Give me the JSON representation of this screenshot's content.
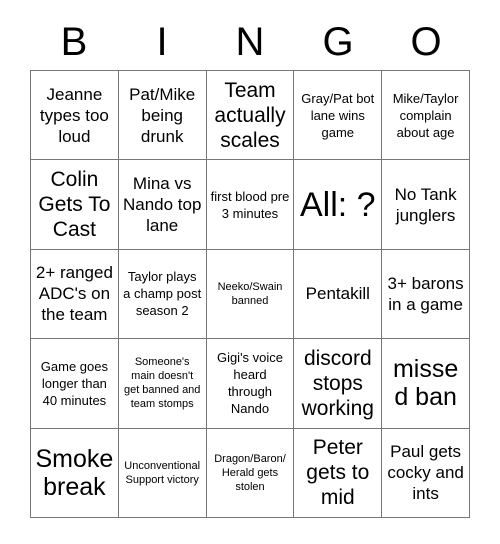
{
  "card": {
    "header_letters": [
      "B",
      "I",
      "N",
      "G",
      "O"
    ],
    "rows": [
      [
        {
          "text": "Jeanne types too loud",
          "size": "sz-md"
        },
        {
          "text": "Pat/Mike being drunk",
          "size": "sz-md"
        },
        {
          "text": "Team actually scales",
          "size": "sz-lg"
        },
        {
          "text": "Gray/Pat bot lane wins game",
          "size": "sz-sm"
        },
        {
          "text": "Mike/Taylor complain about age",
          "size": "sz-sm"
        }
      ],
      [
        {
          "text": "Colin Gets To Cast",
          "size": "sz-lg"
        },
        {
          "text": "Mina vs Nando top lane",
          "size": "sz-md"
        },
        {
          "text": "first blood pre 3 minutes",
          "size": "sz-sm"
        },
        {
          "text": "All: ?",
          "size": "sz-free"
        },
        {
          "text": "No Tank junglers",
          "size": "sz-md"
        }
      ],
      [
        {
          "text": "2+ ranged ADC's on the team",
          "size": "sz-md"
        },
        {
          "text": "Taylor plays a champ post season 2",
          "size": "sz-sm"
        },
        {
          "text": "Neeko/Swain banned",
          "size": "sz-xs"
        },
        {
          "text": "Pentakill",
          "size": "sz-md"
        },
        {
          "text": "3+ barons in a game",
          "size": "sz-md"
        }
      ],
      [
        {
          "text": "Game goes longer than 40 minutes",
          "size": "sz-sm"
        },
        {
          "text": "Someone's main doesn't get banned and team stomps",
          "size": "sz-xs"
        },
        {
          "text": "Gigi's voice heard through Nando",
          "size": "sz-sm"
        },
        {
          "text": "discord stops working",
          "size": "sz-lg"
        },
        {
          "text": "missed ban",
          "size": "sz-xl"
        }
      ],
      [
        {
          "text": "Smoke break",
          "size": "sz-xl"
        },
        {
          "text": "Unconventional Support victory",
          "size": "sz-xs"
        },
        {
          "text": "Dragon/Baron/ Herald gets stolen",
          "size": "sz-xs"
        },
        {
          "text": "Peter gets to mid",
          "size": "sz-lg"
        },
        {
          "text": "Paul gets cocky and ints",
          "size": "sz-md"
        }
      ]
    ]
  },
  "colors": {
    "background": "#ffffff",
    "text": "#000000",
    "grid_line": "#777777"
  }
}
